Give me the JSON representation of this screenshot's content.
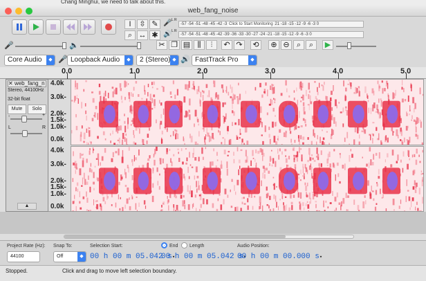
{
  "background_text": "Chang Minghui, we need to talk about this.",
  "window": {
    "title": "web_fang_noise"
  },
  "meters": {
    "record_scale": "-57 -54 -51 -48 -45 -42 -3",
    "record_hint": "Click to Start Monitoring",
    "record_tail": "21 -18 -15 -12 -9 -6 -3 0",
    "play_scale": "-57 -54 -51 -48 -45 -42 -39 -36 -33 -30 -27 -24 -21 -18 -15 -12 -9 -6 -3 0",
    "record_channels": "L R",
    "play_channels": "L R"
  },
  "devices": {
    "host": "Core Audio",
    "input": "Loopback Audio",
    "channels": "2 (Stereo)...",
    "output": "FastTrack Pro"
  },
  "ruler": {
    "ticks": [
      "0.0",
      "1.0",
      "2.0",
      "3.0",
      "4.0",
      "5.0"
    ]
  },
  "track": {
    "name": "web_fang_n",
    "info1": "Stereo, 44100Hz",
    "info2": "32-bit float",
    "mute": "Mute",
    "solo": "Solo",
    "gain_minus": "-",
    "gain_plus": "+",
    "pan_left": "L",
    "pan_right": "R",
    "scale_labels": [
      "4.0k",
      "3.0k-",
      "2.0k-",
      "1.5k-",
      "1.0k-",
      "0.0k"
    ]
  },
  "footer": {
    "project_rate_label": "Project Rate (Hz):",
    "project_rate": "44100",
    "snap_label": "Snap To:",
    "snap_value": "Off",
    "selection_start_label": "Selection Start:",
    "end_label": "End",
    "length_label": "Length",
    "audio_position_label": "Audio Position:",
    "sel_start": "00 h 00 m 05.042 s",
    "sel_end": "00 h 00 m 05.042 s",
    "audio_pos": "00 h 00 m 00.000 s"
  },
  "status": {
    "state": "Stopped.",
    "hint": "Click and drag to move left selection boundary."
  },
  "colors": {
    "accent": "#3c82f0",
    "spectrogram_low": "#fde8ea",
    "spectrogram_mid": "#e8324a",
    "spectrogram_high": "#8a6cf0"
  }
}
